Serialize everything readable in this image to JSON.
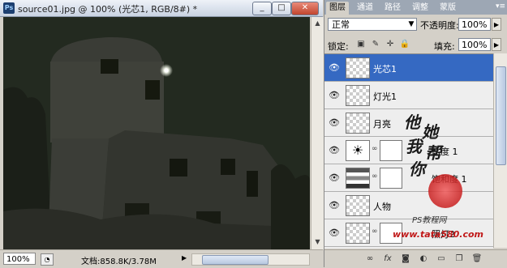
{
  "document_window": {
    "icon": "Ps",
    "title": "source01.jpg @ 100% (光芯1, RGB/8#) *",
    "buttons": {
      "minimize": "_",
      "maximize": "□",
      "close": "✕"
    },
    "zoom": "100%",
    "doc_info": "文档:858.8K/3.78M"
  },
  "panel": {
    "tabs": [
      "图层",
      "通道",
      "路径",
      "调整",
      "蒙版"
    ],
    "active_tab": "图层",
    "blend_mode": "正常",
    "opacity_label": "不透明度:",
    "opacity_value": "100%",
    "lock_label": "锁定:",
    "fill_label": "填充:",
    "fill_value": "100%",
    "layers": [
      {
        "name": "光芯1",
        "selected": true,
        "visible": true,
        "type": "pixel"
      },
      {
        "name": "灯光1",
        "selected": false,
        "visible": true,
        "type": "pixel"
      },
      {
        "name": "月亮",
        "selected": false,
        "visible": true,
        "type": "pixel"
      },
      {
        "name": "比度 1",
        "selected": false,
        "visible": true,
        "type": "adjustment",
        "icon": "brightness-icon"
      },
      {
        "name": "饱和度 1",
        "selected": false,
        "visible": true,
        "type": "adjustment",
        "icon": "hue-saturation-icon"
      },
      {
        "name": "人物",
        "selected": false,
        "visible": true,
        "type": "pixel"
      },
      {
        "name": "照灯2",
        "selected": false,
        "visible": true,
        "type": "pixel-mask"
      },
      {
        "name": "",
        "selected": false,
        "visible": true,
        "type": "pixel-mask"
      }
    ],
    "bottom_icons": [
      "link-icon",
      "fx-icon",
      "add-mask-icon",
      "adjustment-icon",
      "group-icon",
      "new-layer-icon",
      "trash-icon"
    ],
    "bottom_glyphs": [
      "∞",
      "fx",
      "◙",
      "◐",
      "▭",
      "❐",
      "🗑"
    ]
  },
  "watermark": {
    "chars": [
      "他",
      "她",
      "我",
      "帮",
      "你"
    ],
    "site_cn": "PS教程网",
    "site_url": "www.tata580.com"
  }
}
